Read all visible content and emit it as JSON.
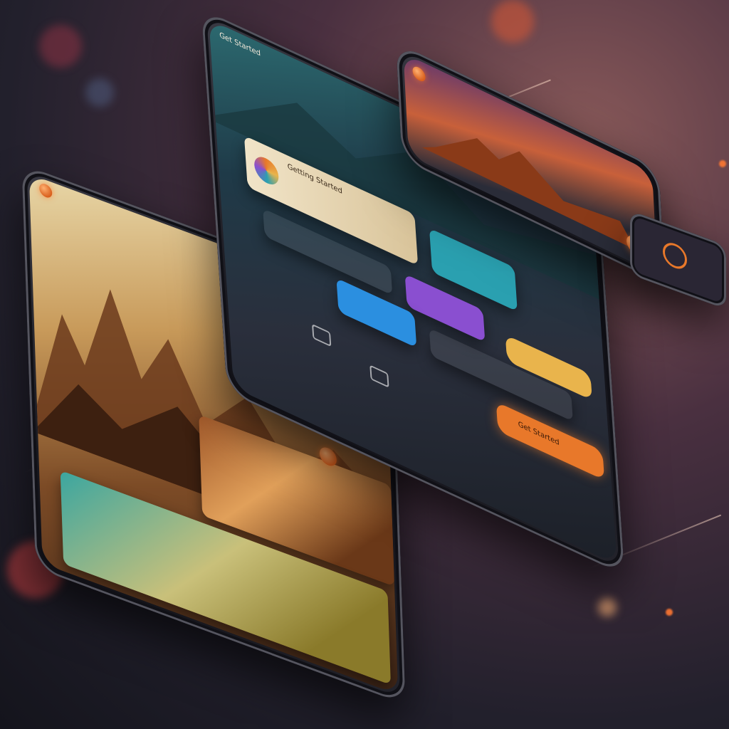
{
  "colors": {
    "accent": "#e8782a",
    "pill_yellow": "#e9b44c",
    "card_purple": "#8a4fd0",
    "card_teal": "#2aa0b0",
    "card_blue": "#2b8fe0"
  },
  "main_phone": {
    "header_title": "Get Started",
    "card_title": "Getting Started",
    "pill_primary": "Get Started"
  },
  "icons": [
    "menu-icon",
    "search-icon",
    "settings-icon",
    "play-icon",
    "wifi-icon"
  ]
}
